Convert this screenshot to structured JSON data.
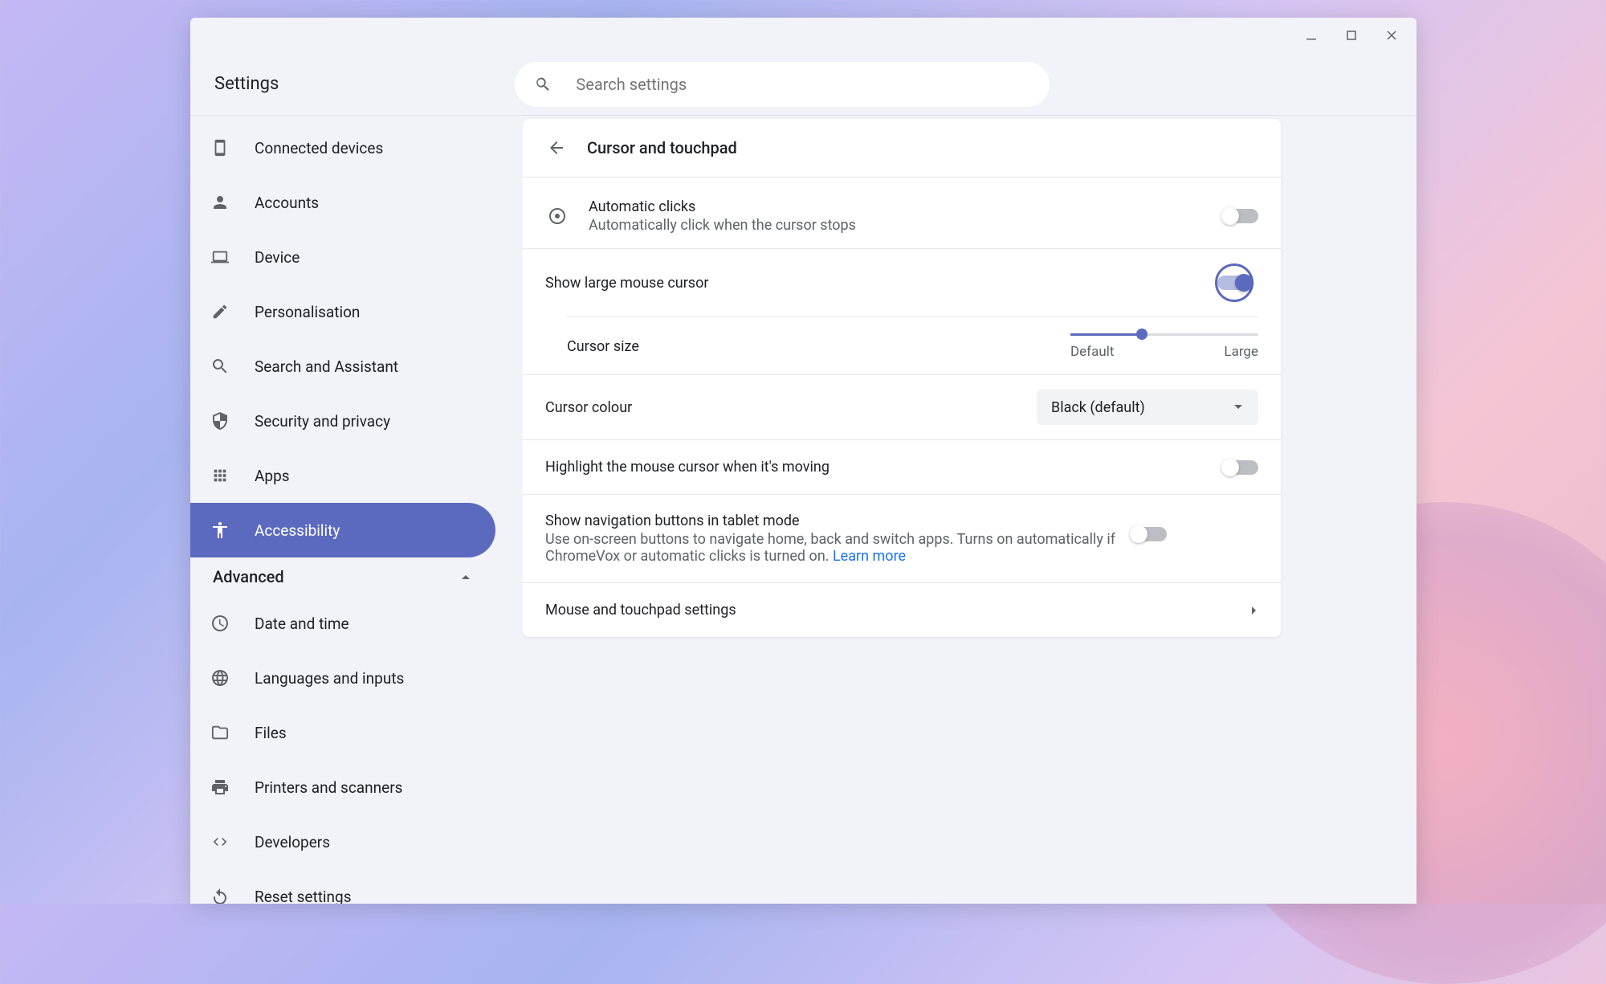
{
  "app_title": "Settings",
  "search": {
    "placeholder": "Search settings"
  },
  "sidebar": {
    "items": [
      {
        "label": "Connected devices"
      },
      {
        "label": "Accounts"
      },
      {
        "label": "Device"
      },
      {
        "label": "Personalisation"
      },
      {
        "label": "Search and Assistant"
      },
      {
        "label": "Security and privacy"
      },
      {
        "label": "Apps"
      },
      {
        "label": "Accessibility"
      }
    ],
    "section_label": "Advanced",
    "advanced": [
      {
        "label": "Date and time"
      },
      {
        "label": "Languages and inputs"
      },
      {
        "label": "Files"
      },
      {
        "label": "Printers and scanners"
      },
      {
        "label": "Developers"
      },
      {
        "label": "Reset settings"
      }
    ]
  },
  "main": {
    "title": "Cursor and touchpad",
    "auto_clicks": {
      "title": "Automatic clicks",
      "sub": "Automatically click when the cursor stops",
      "on": false
    },
    "large_cursor": {
      "title": "Show large mouse cursor",
      "on": true
    },
    "cursor_size": {
      "label": "Cursor size",
      "min_label": "Default",
      "max_label": "Large",
      "percent": 38
    },
    "cursor_colour": {
      "label": "Cursor colour",
      "value": "Black (default)"
    },
    "highlight": {
      "title": "Highlight the mouse cursor when it's moving",
      "on": false
    },
    "nav_buttons": {
      "title": "Show navigation buttons in tablet mode",
      "sub": "Use on-screen buttons to navigate home, back and switch apps. Turns on automatically if ChromeVox or automatic clicks is turned on. ",
      "link": "Learn more",
      "on": false
    },
    "mouse_settings": {
      "title": "Mouse and touchpad settings"
    }
  }
}
